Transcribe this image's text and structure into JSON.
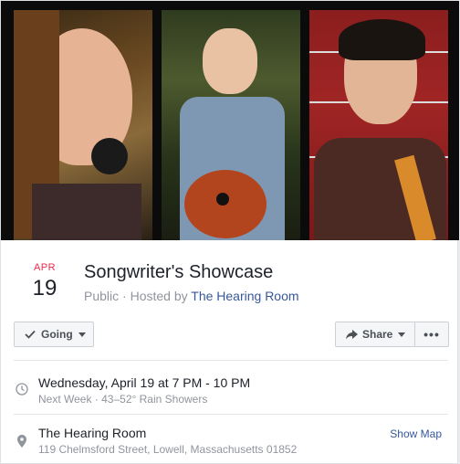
{
  "event": {
    "month": "APR",
    "day": "19",
    "title": "Songwriter's Showcase",
    "privacy": "Public",
    "hosted_prefix": " · Hosted by ",
    "host": "The Hearing Room"
  },
  "actions": {
    "going_label": "Going",
    "share_label": "Share",
    "more_label": "•••"
  },
  "details": {
    "time_main": "Wednesday, April 19 at 7 PM - 10 PM",
    "time_sub": "Next Week · 43–52° Rain Showers",
    "place_main": "The Hearing Room",
    "place_sub": "119 Chelmsford Street, Lowell, Massachusetts 01852",
    "show_map": "Show Map"
  },
  "colors": {
    "month_red": "#f02849",
    "link_blue": "#365899"
  },
  "icons": [
    "checkmark-icon",
    "share-arrow-icon",
    "clock-icon",
    "location-pin-icon"
  ]
}
